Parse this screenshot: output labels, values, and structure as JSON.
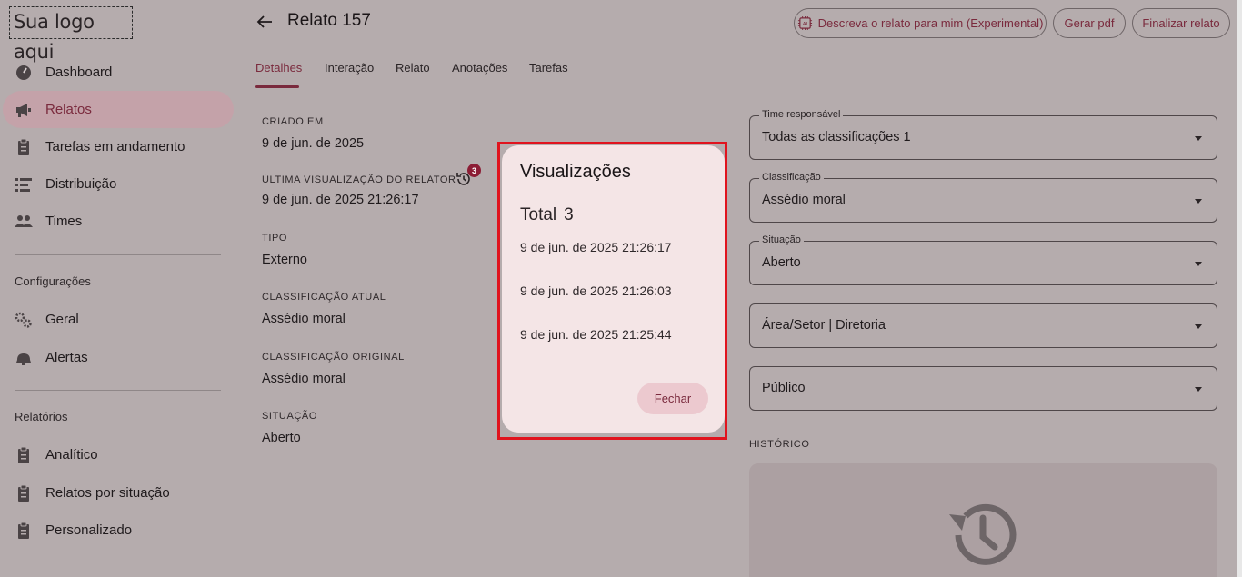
{
  "brand": {
    "logo_text": "Sua logo aqui"
  },
  "sidebar": {
    "items": [
      {
        "label": "Dashboard",
        "icon": "dashboard-icon"
      },
      {
        "label": "Relatos",
        "icon": "megaphone-icon",
        "active": true
      },
      {
        "label": "Tarefas em andamento",
        "icon": "clipboard-icon"
      },
      {
        "label": "Distribuição",
        "icon": "distribution-icon"
      },
      {
        "label": "Times",
        "icon": "people-icon"
      }
    ],
    "config_title": "Configurações",
    "config_items": [
      {
        "label": "Geral",
        "icon": "gears-icon"
      },
      {
        "label": "Alertas",
        "icon": "alert-icon"
      }
    ],
    "reports_title": "Relatórios",
    "report_items": [
      {
        "label": "Analítico",
        "icon": "clipboard-icon"
      },
      {
        "label": "Relatos por situação",
        "icon": "clipboard-icon"
      },
      {
        "label": "Personalizado",
        "icon": "clipboard-icon"
      }
    ]
  },
  "header": {
    "title": "Relato 157",
    "btn_describe": "Descreva o relato para mim (Experimental)",
    "btn_pdf": "Gerar pdf",
    "btn_finish": "Finalizar relato"
  },
  "tabs": [
    "Detalhes",
    "Interação",
    "Relato",
    "Anotações",
    "Tarefas"
  ],
  "details": {
    "created_label": "CRIADO EM",
    "created_value": "9 de jun. de 2025",
    "last_view_label": "ÚLTIMA VISUALIZAÇÃO DO RELATOR",
    "last_view_value": "9 de jun. de 2025 21:26:17",
    "view_count_badge": "3",
    "type_label": "TIPO",
    "type_value": "Externo",
    "current_class_label": "CLASSIFICAÇÃO ATUAL",
    "current_class_value": "Assédio moral",
    "original_class_label": "CLASSIFICAÇÃO ORIGINAL",
    "original_class_value": "Assédio moral",
    "status_label": "SITUAÇÃO",
    "status_value": "Aberto"
  },
  "selects": {
    "team_label": "Time responsável",
    "team_value": "Todas as classificações 1",
    "class_label": "Classificação",
    "class_value": "Assédio moral",
    "status_label": "Situação",
    "status_value": "Aberto",
    "area_value": "Área/Setor | Diretoria",
    "public_value": "Público"
  },
  "history": {
    "label": "HISTÓRICO"
  },
  "dialog": {
    "title": "Visualizações",
    "total_label": "Total",
    "total_value": "3",
    "entries": [
      "9 de jun. de 2025 21:26:17",
      "9 de jun. de 2025 21:26:03",
      "9 de jun. de 2025 21:25:44"
    ],
    "close_label": "Fechar"
  },
  "colors": {
    "accent": "#7a2a3d",
    "highlight": "#e0141e",
    "badge": "#8c1d35"
  }
}
